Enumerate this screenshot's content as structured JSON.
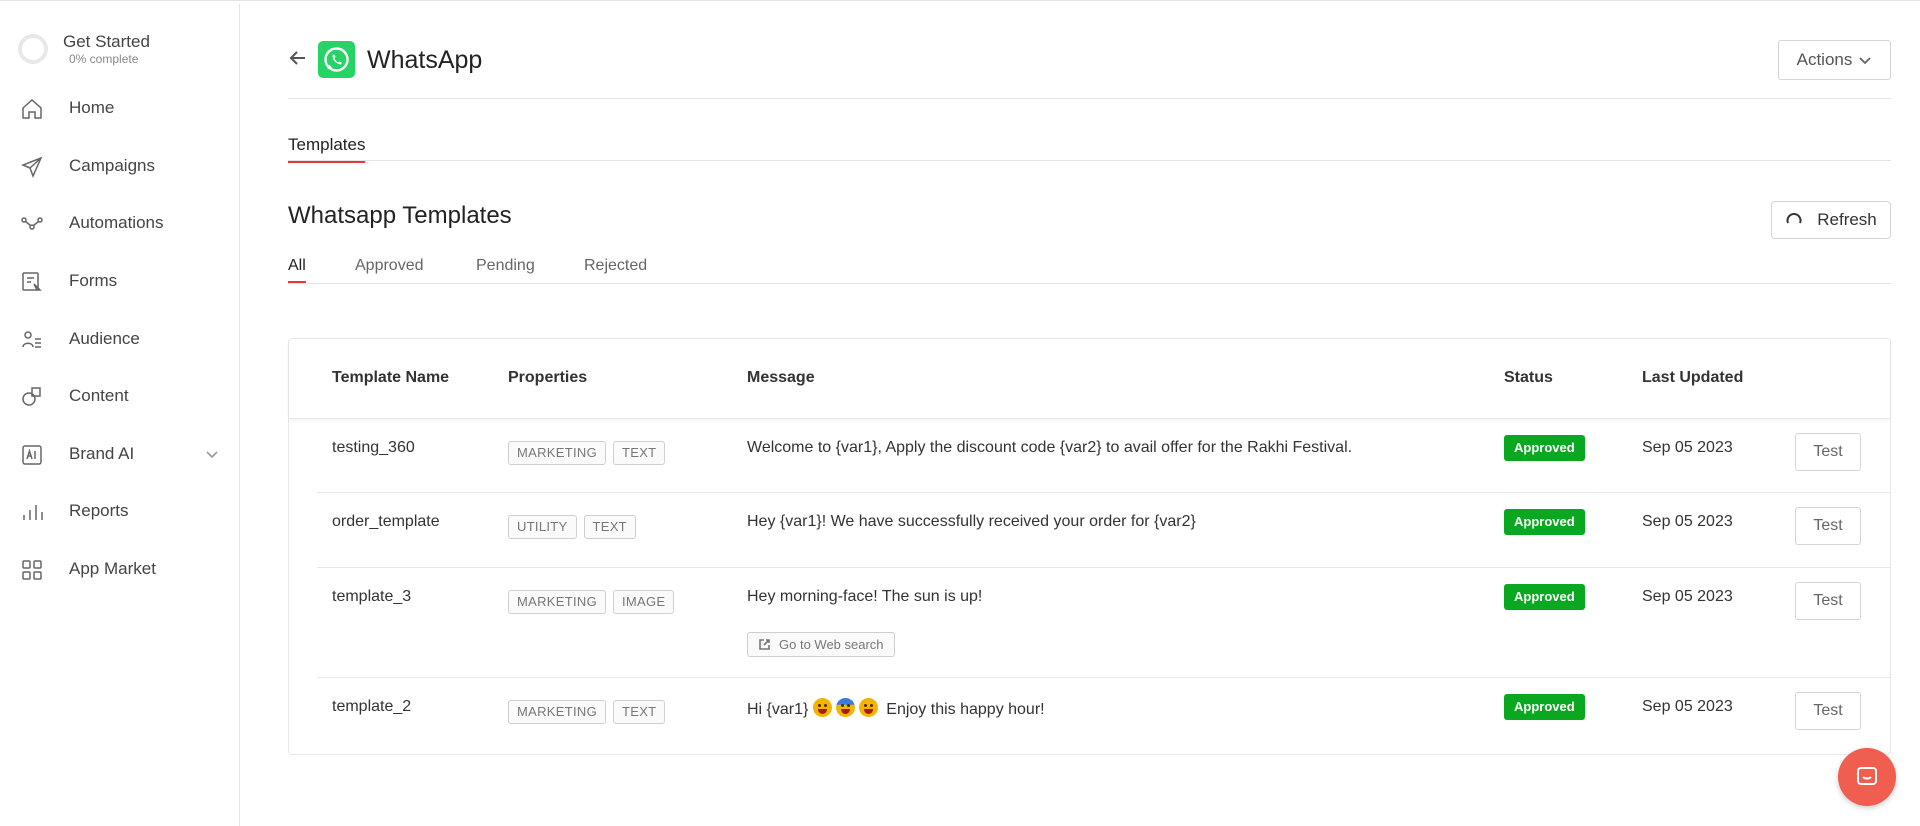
{
  "sidebar": {
    "get_started": {
      "title": "Get Started",
      "progress_label": "0% complete",
      "progress": 0
    },
    "items": [
      {
        "label": "Home",
        "icon": "home-icon"
      },
      {
        "label": "Campaigns",
        "icon": "send-icon"
      },
      {
        "label": "Automations",
        "icon": "workflow-icon"
      },
      {
        "label": "Forms",
        "icon": "form-icon"
      },
      {
        "label": "Audience",
        "icon": "users-icon"
      },
      {
        "label": "Content",
        "icon": "shapes-icon"
      },
      {
        "label": "Brand AI",
        "icon": "ai-icon",
        "has_chevron": true
      },
      {
        "label": "Reports",
        "icon": "bar-chart-icon"
      },
      {
        "label": "App Market",
        "icon": "grid-icon"
      }
    ]
  },
  "header": {
    "title": "WhatsApp",
    "actions_label": "Actions",
    "brand_color": "#25d366"
  },
  "primary_tabs": [
    {
      "label": "Templates",
      "active": true
    }
  ],
  "section": {
    "title": "Whatsapp Templates",
    "refresh_label": "Refresh"
  },
  "filter_tabs": [
    {
      "label": "All",
      "active": true
    },
    {
      "label": "Approved",
      "active": false
    },
    {
      "label": "Pending",
      "active": false
    },
    {
      "label": "Rejected",
      "active": false
    }
  ],
  "table": {
    "columns": [
      "Template Name",
      "Properties",
      "Message",
      "Status",
      "Last Updated"
    ],
    "rows": [
      {
        "name": "testing_360",
        "tags": [
          "MARKETING",
          "TEXT"
        ],
        "message": "Welcome to {var1}, Apply the discount code {var2} to avail offer for the Rakhi Festival.",
        "status": "Approved",
        "updated": "Sep 05 2023",
        "action": "Test"
      },
      {
        "name": "order_template",
        "tags": [
          "UTILITY",
          "TEXT"
        ],
        "message": "Hey {var1}! We have successfully received your order for {var2}",
        "status": "Approved",
        "updated": "Sep 05 2023",
        "action": "Test"
      },
      {
        "name": "template_3",
        "tags": [
          "MARKETING",
          "IMAGE"
        ],
        "message": "Hey morning-face! The sun is up!",
        "button_label": "Go to Web search",
        "status": "Approved",
        "updated": "Sep 05 2023",
        "action": "Test"
      },
      {
        "name": "template_2",
        "tags": [
          "MARKETING",
          "TEXT"
        ],
        "message_prefix": "Hi {var1}",
        "message_suffix": "Enjoy this happy hour!",
        "status": "Approved",
        "updated": "Sep 05 2023",
        "action": "Test"
      }
    ]
  },
  "colors": {
    "accent": "#e53935",
    "approved": "#0aa820",
    "chat_fab": "#ef5e4e"
  }
}
